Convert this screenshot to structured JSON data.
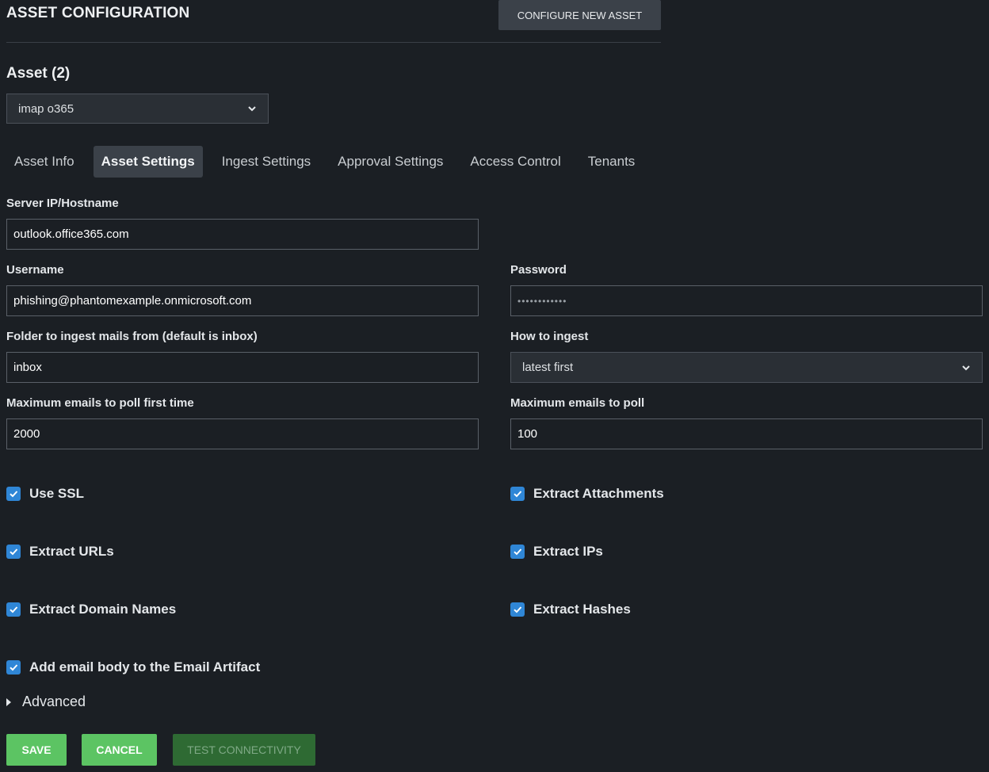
{
  "header": {
    "title": "ASSET CONFIGURATION",
    "configure_button": "CONFIGURE NEW ASSET"
  },
  "asset": {
    "count_label": "Asset (2)",
    "selected": "imap o365"
  },
  "tabs": [
    {
      "label": "Asset Info",
      "active": false
    },
    {
      "label": "Asset Settings",
      "active": true
    },
    {
      "label": "Ingest Settings",
      "active": false
    },
    {
      "label": "Approval Settings",
      "active": false
    },
    {
      "label": "Access Control",
      "active": false
    },
    {
      "label": "Tenants",
      "active": false
    }
  ],
  "fields": {
    "server": {
      "label": "Server IP/Hostname",
      "value": "outlook.office365.com"
    },
    "username": {
      "label": "Username",
      "value": "phishing@phantomexample.onmicrosoft.com"
    },
    "password": {
      "label": "Password",
      "value": "••••••••••••"
    },
    "folder": {
      "label": "Folder to ingest mails from (default is inbox)",
      "value": "inbox"
    },
    "how_to_ingest": {
      "label": "How to ingest",
      "value": "latest first"
    },
    "max_first": {
      "label": "Maximum emails to poll first time",
      "value": "2000"
    },
    "max_poll": {
      "label": "Maximum emails to poll",
      "value": "100"
    }
  },
  "checkboxes": {
    "use_ssl": {
      "label": "Use SSL",
      "checked": true
    },
    "extract_attachments": {
      "label": "Extract Attachments",
      "checked": true
    },
    "extract_urls": {
      "label": "Extract URLs",
      "checked": true
    },
    "extract_ips": {
      "label": "Extract IPs",
      "checked": true
    },
    "extract_domains": {
      "label": "Extract Domain Names",
      "checked": true
    },
    "extract_hashes": {
      "label": "Extract Hashes",
      "checked": true
    },
    "add_body": {
      "label": "Add email body to the Email Artifact",
      "checked": true
    }
  },
  "advanced": {
    "label": "Advanced"
  },
  "actions": {
    "save": "SAVE",
    "cancel": "CANCEL",
    "test": "TEST CONNECTIVITY"
  },
  "colors": {
    "background": "#1b1f24",
    "accent_green": "#5cc463",
    "checkbox_blue": "#2f86d6",
    "disabled_green": "#2e6a33"
  }
}
